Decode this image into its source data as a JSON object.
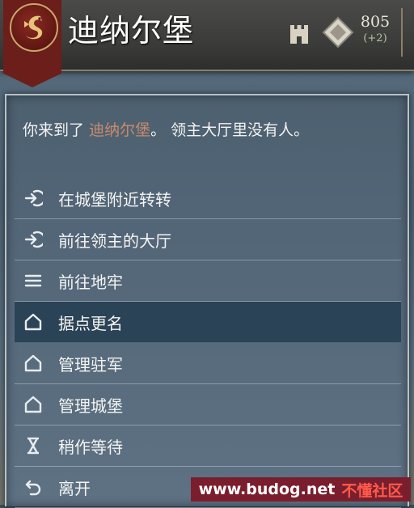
{
  "header": {
    "title": "迪纳尔堡",
    "gold": "805",
    "gold_delta": "(+2)",
    "crest_icon": "dragon-crest-icon",
    "banner_color": "#6b1e1a"
  },
  "intro": {
    "prefix": "你来到了",
    "place": "迪纳尔堡",
    "suffix": "。 领主大厅里没有人。",
    "place_color": "#c98b6b"
  },
  "menu": [
    {
      "label": "在城堡附近转转",
      "icon": "arrow-enter-icon"
    },
    {
      "label": "前往领主的大厅",
      "icon": "arrow-enter-icon"
    },
    {
      "label": "前往地牢",
      "icon": "list-icon"
    },
    {
      "label": "据点更名",
      "icon": "house-icon",
      "selected": true
    },
    {
      "label": "管理驻军",
      "icon": "house-icon"
    },
    {
      "label": "管理城堡",
      "icon": "house-icon"
    },
    {
      "label": "稍作等待",
      "icon": "hourglass-icon"
    },
    {
      "label": "离开",
      "icon": "return-icon"
    }
  ],
  "watermark": {
    "url": "www.budog.net",
    "name": "不懂社区"
  }
}
